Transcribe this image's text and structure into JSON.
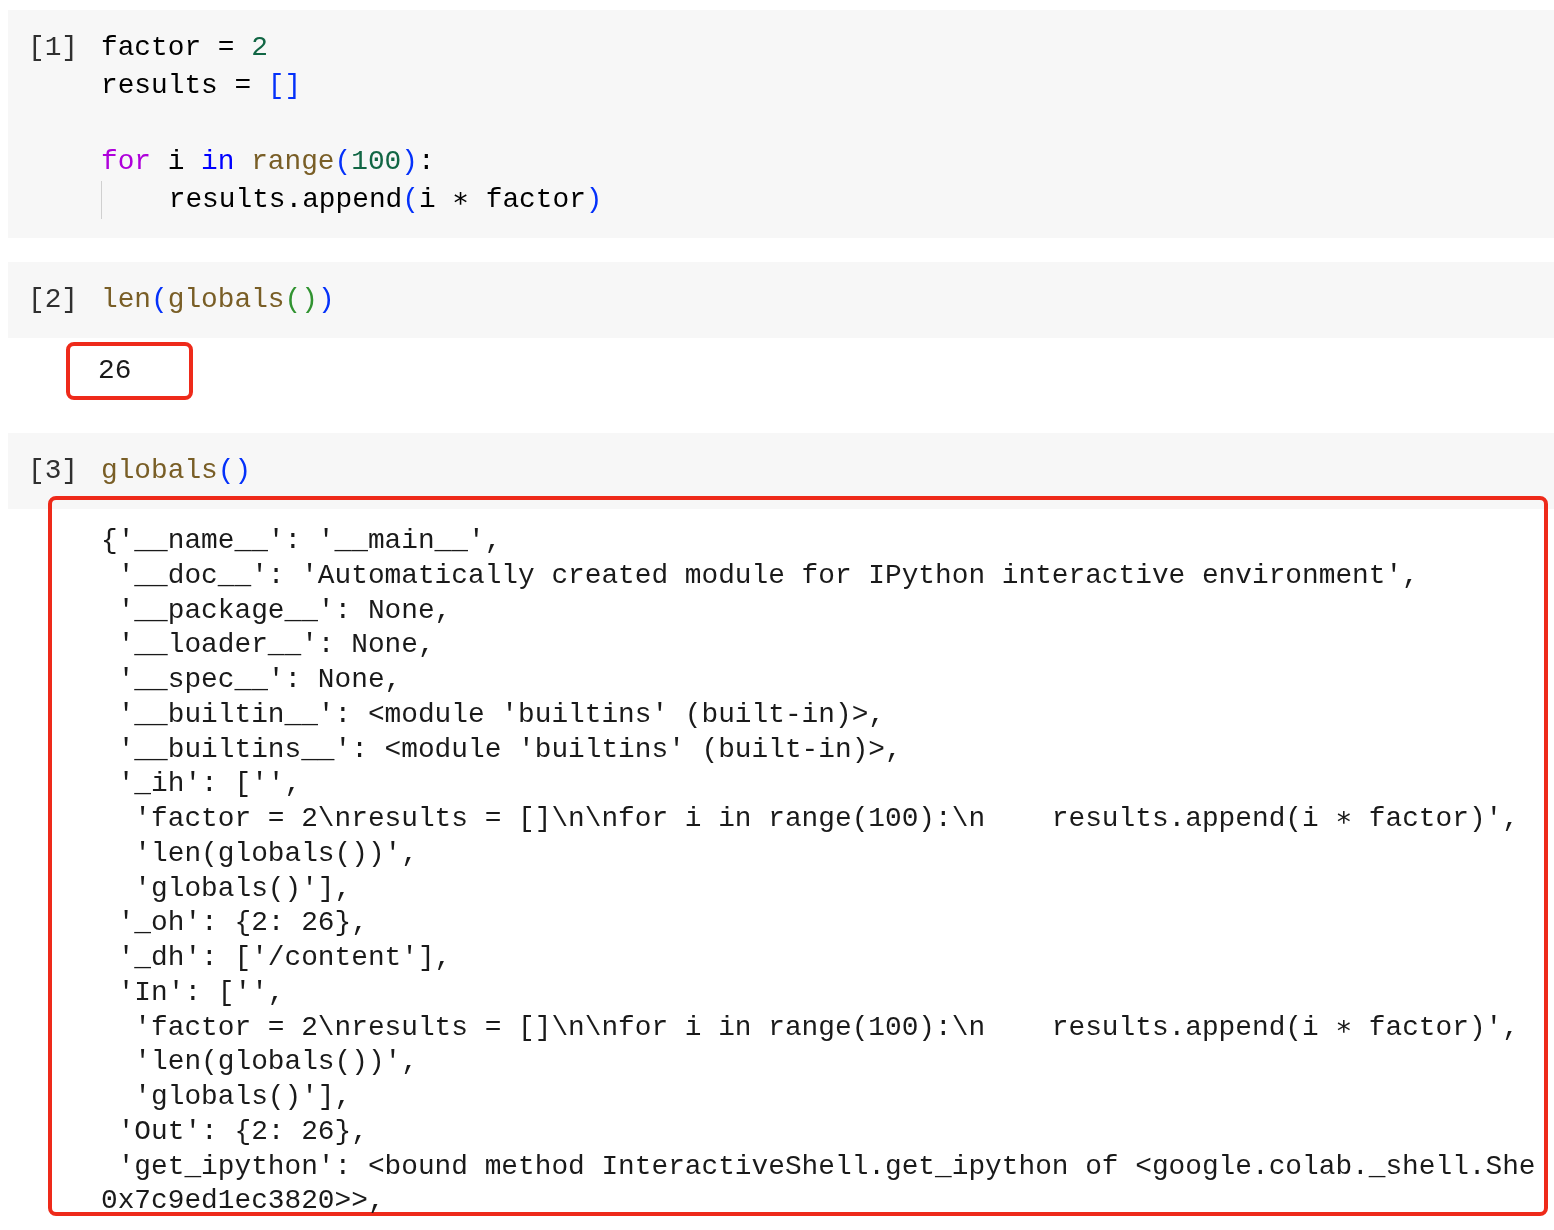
{
  "cells": [
    {
      "prompt": "[1]",
      "lines": [
        {
          "tokens": [
            {
              "text": "factor",
              "kind": "plain"
            },
            {
              "text": " = ",
              "kind": "plain"
            },
            {
              "text": "2",
              "kind": "number"
            }
          ]
        },
        {
          "tokens": [
            {
              "text": "results",
              "kind": "plain"
            },
            {
              "text": " = ",
              "kind": "plain"
            },
            {
              "text": "[]",
              "kind": "bracket"
            }
          ]
        },
        {
          "gap_before": true,
          "tokens": [
            {
              "text": "for",
              "kind": "keyword"
            },
            {
              "text": " i ",
              "kind": "plain"
            },
            {
              "text": "in ",
              "kind": "operator"
            },
            {
              "text": "range",
              "kind": "builtin"
            },
            {
              "text": "(",
              "kind": "bracket"
            },
            {
              "text": "100",
              "kind": "number"
            },
            {
              "text": ")",
              "kind": "bracket"
            },
            {
              "text": ":",
              "kind": "plain"
            }
          ]
        },
        {
          "indent_guide": true,
          "tokens": [
            {
              "text": "    results.append",
              "kind": "plain"
            },
            {
              "text": "(",
              "kind": "bracket"
            },
            {
              "text": "i ∗ factor",
              "kind": "plain"
            },
            {
              "text": ")",
              "kind": "bracket"
            }
          ]
        }
      ]
    },
    {
      "prompt": "[2]",
      "lines": [
        {
          "tokens": [
            {
              "text": "len",
              "kind": "builtin"
            },
            {
              "text": "(",
              "kind": "bracket"
            },
            {
              "text": "globals",
              "kind": "builtin"
            },
            {
              "text": "()",
              "kind": "bracket2"
            },
            {
              "text": ")",
              "kind": "bracket"
            }
          ]
        }
      ],
      "output": {
        "highlighted": true,
        "lines": [
          "26"
        ]
      }
    },
    {
      "prompt": "[3]",
      "lines": [
        {
          "tokens": [
            {
              "text": "globals",
              "kind": "builtin"
            },
            {
              "text": "()",
              "kind": "bracket"
            }
          ]
        }
      ],
      "output": {
        "highlighted": true,
        "lines": [
          "{'__name__': '__main__',",
          " '__doc__': 'Automatically created module for IPython interactive environment',",
          " '__package__': None,",
          " '__loader__': None,",
          " '__spec__': None,",
          " '__builtin__': <module 'builtins' (built-in)>,",
          " '__builtins__': <module 'builtins' (built-in)>,",
          " '_ih': ['',",
          "  'factor = 2\\nresults = []\\n\\nfor i in range(100):\\n    results.append(i ∗ factor)',",
          "  'len(globals())',",
          "  'globals()'],",
          " '_oh': {2: 26},",
          " '_dh': ['/content'],",
          " 'In': ['',",
          "  'factor = 2\\nresults = []\\n\\nfor i in range(100):\\n    results.append(i ∗ factor)',",
          "  'len(globals())',",
          "  'globals()'],",
          " 'Out': {2: 26},",
          " 'get_ipython': <bound method InteractiveShell.get_ipython of <google.colab._shell.She",
          "0x7c9ed1ec3820>>,"
        ]
      }
    }
  ]
}
